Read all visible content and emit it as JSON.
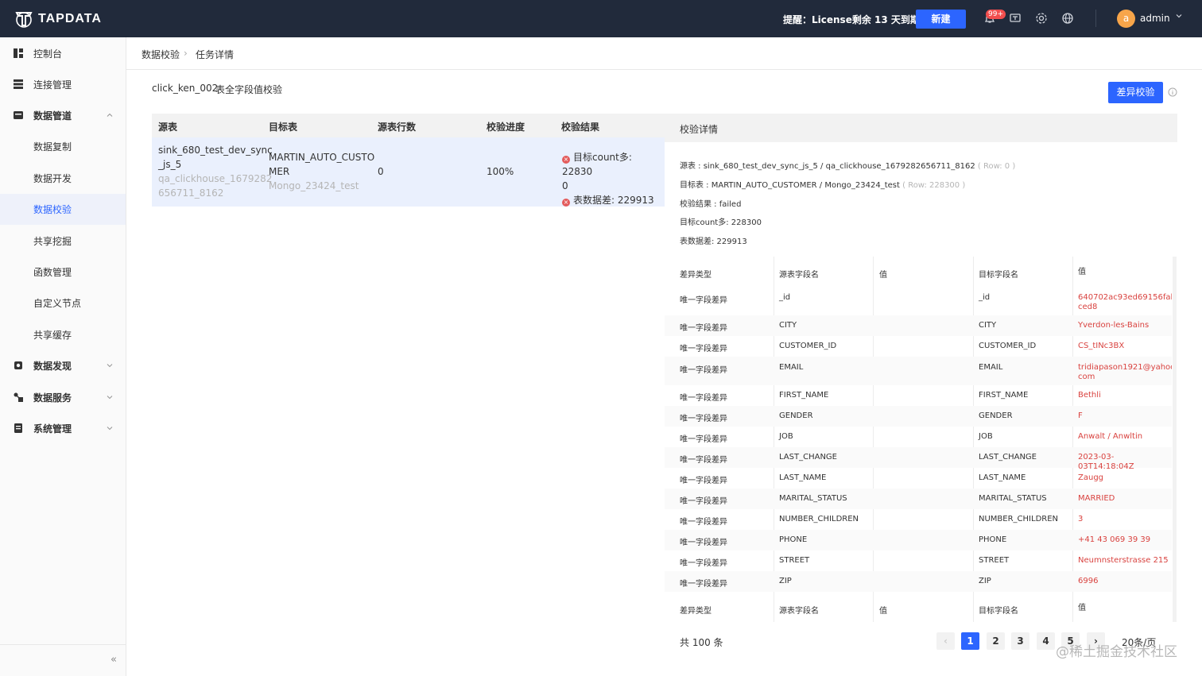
{
  "header": {
    "brand": "TAPDATA",
    "license_notice": "提醒：License剩余 13 天到期",
    "new_label": "新建",
    "notification_badge": "99+",
    "user_initial": "a",
    "user_name": "admin"
  },
  "sidebar": {
    "items": [
      {
        "label": "控制台",
        "icon": "dashboard-icon"
      },
      {
        "label": "连接管理",
        "icon": "connection-icon"
      },
      {
        "label": "数据管道",
        "icon": "pipeline-icon",
        "expanded": true
      },
      {
        "label": "数据复制"
      },
      {
        "label": "数据开发"
      },
      {
        "label": "数据校验",
        "active": true
      },
      {
        "label": "共享挖掘"
      },
      {
        "label": "函数管理"
      },
      {
        "label": "自定义节点"
      },
      {
        "label": "共享缓存"
      },
      {
        "label": "数据发现",
        "icon": "discovery-icon"
      },
      {
        "label": "数据服务",
        "icon": "service-icon"
      },
      {
        "label": "系统管理",
        "icon": "system-icon"
      }
    ],
    "collapse_glyph": "«"
  },
  "breadcrumb": {
    "parent": "数据校验",
    "current": "任务详情"
  },
  "task": {
    "name": "click_ken_002",
    "type": "表全字段值校验",
    "diff_button": "差异校验"
  },
  "summary_table": {
    "headers": [
      "源表",
      "目标表",
      "源表行数",
      "校验进度",
      "校验结果"
    ],
    "row": {
      "source_line1": "sink_680_test_dev_sync",
      "source_line2": "_js_5",
      "source_conn1": "qa_clickhouse_1679282",
      "source_conn2": "656711_8162",
      "target_line1": "MARTIN_AUTO_CUSTO",
      "target_line2": "MER",
      "target_conn": "Mongo_23424_test",
      "source_rows": "0",
      "progress": "100%",
      "result_line1": "目标count多: 22830",
      "result_line2": "0",
      "result_line3": "表数据差: 229913"
    }
  },
  "details": {
    "title": "校验详情",
    "source_label": "源表 : sink_680_test_dev_sync_js_5 / qa_clickhouse_1679282656711_8162",
    "source_rows": "( Row: 0 )",
    "target_label": "目标表 : MARTIN_AUTO_CUSTOMER / Mongo_23424_test",
    "target_rows": "( Row: 228300 )",
    "result": "校验结果 : failed",
    "count_more": "目标count多: 228300",
    "data_diff": "表数据差: 229913",
    "columns": [
      "差异类型",
      "源表字段名",
      "值",
      "目标字段名",
      "值"
    ],
    "rows": [
      {
        "type": "唯一字段差异",
        "src": "_id",
        "src_val": "",
        "tgt": "_id",
        "tgt_val": "640702ac93ed69156fab ced8"
      },
      {
        "type": "唯一字段差异",
        "src": "CITY",
        "src_val": "",
        "tgt": "CITY",
        "tgt_val": "Yverdon-les-Bains"
      },
      {
        "type": "唯一字段差异",
        "src": "CUSTOMER_ID",
        "src_val": "",
        "tgt": "CUSTOMER_ID",
        "tgt_val": "CS_tINc3BX"
      },
      {
        "type": "唯一字段差异",
        "src": "EMAIL",
        "src_val": "",
        "tgt": "EMAIL",
        "tgt_val": "tridiapason1921@yahoo. com"
      },
      {
        "type": "唯一字段差异",
        "src": "FIRST_NAME",
        "src_val": "",
        "tgt": "FIRST_NAME",
        "tgt_val": "Bethli"
      },
      {
        "type": "唯一字段差异",
        "src": "GENDER",
        "src_val": "",
        "tgt": "GENDER",
        "tgt_val": "F"
      },
      {
        "type": "唯一字段差异",
        "src": "JOB",
        "src_val": "",
        "tgt": "JOB",
        "tgt_val": "Anwalt / Anwltin"
      },
      {
        "type": "唯一字段差异",
        "src": "LAST_CHANGE",
        "src_val": "",
        "tgt": "LAST_CHANGE",
        "tgt_val": "2023-03-03T14:18:04Z"
      },
      {
        "type": "唯一字段差异",
        "src": "LAST_NAME",
        "src_val": "",
        "tgt": "LAST_NAME",
        "tgt_val": "Zaugg"
      },
      {
        "type": "唯一字段差异",
        "src": "MARITAL_STATUS",
        "src_val": "",
        "tgt": "MARITAL_STATUS",
        "tgt_val": "MARRIED"
      },
      {
        "type": "唯一字段差异",
        "src": "NUMBER_CHILDREN",
        "src_val": "",
        "tgt": "NUMBER_CHILDREN",
        "tgt_val": "3"
      },
      {
        "type": "唯一字段差异",
        "src": "PHONE",
        "src_val": "",
        "tgt": "PHONE",
        "tgt_val": "+41 43 069 39 39"
      },
      {
        "type": "唯一字段差异",
        "src": "STREET",
        "src_val": "",
        "tgt": "STREET",
        "tgt_val": "Neumnsterstrasse 215"
      },
      {
        "type": "唯一字段差异",
        "src": "ZIP",
        "src_val": "",
        "tgt": "ZIP",
        "tgt_val": "6996"
      }
    ]
  },
  "pagination": {
    "total": "共 100 条",
    "pages": [
      "1",
      "2",
      "3",
      "4",
      "5"
    ],
    "current": "1",
    "page_size": "20条/页",
    "prev": "‹",
    "next": "›"
  },
  "watermark": "@稀土掘金技术社区",
  "colors": {
    "primary": "#2c65ff",
    "header_bg": "#212a3b",
    "error": "#d9423f"
  }
}
